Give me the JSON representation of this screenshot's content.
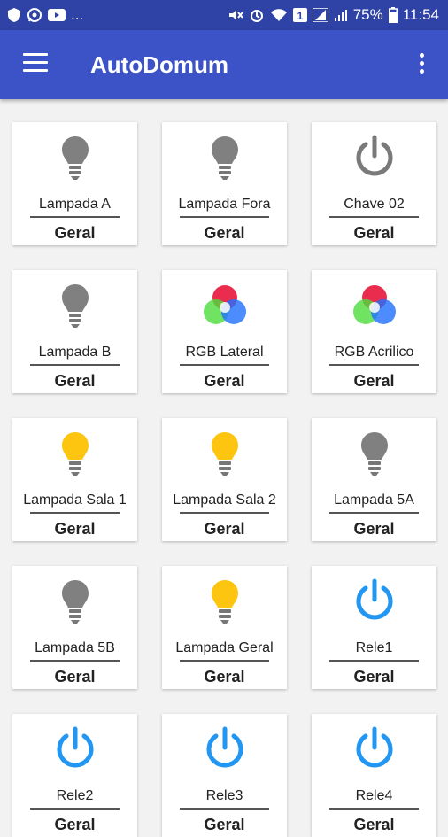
{
  "status_bar": {
    "left_text": "...",
    "battery": "75%",
    "time": "11:54",
    "icons": [
      "shield-icon",
      "whatsapp-icon",
      "youtube-icon",
      "mute-icon",
      "alarm-icon",
      "wifi-icon",
      "notification-1-icon",
      "signal-icon",
      "signal-2-icon"
    ]
  },
  "app_bar": {
    "title": "AutoDomum"
  },
  "colors": {
    "app_bar": "#3b53c6",
    "status_bar": "#2f43a6",
    "bulb_on": "#fdc50f",
    "bulb_off": "#808080",
    "power_blue": "#2196f3",
    "power_gray": "#7a7a7a"
  },
  "devices": [
    {
      "name": "Lampada A",
      "group": "Geral",
      "icon": "bulb-off"
    },
    {
      "name": "Lampada Fora",
      "group": "Geral",
      "icon": "bulb-off"
    },
    {
      "name": "Chave 02",
      "group": "Geral",
      "icon": "power-gray"
    },
    {
      "name": "Lampada B",
      "group": "Geral",
      "icon": "bulb-off"
    },
    {
      "name": "RGB Lateral",
      "group": "Geral",
      "icon": "rgb"
    },
    {
      "name": "RGB Acrilico",
      "group": "Geral",
      "icon": "rgb"
    },
    {
      "name": "Lampada Sala 1",
      "group": "Geral",
      "icon": "bulb-on"
    },
    {
      "name": "Lampada Sala 2",
      "group": "Geral",
      "icon": "bulb-on"
    },
    {
      "name": "Lampada 5A",
      "group": "Geral",
      "icon": "bulb-off"
    },
    {
      "name": "Lampada 5B",
      "group": "Geral",
      "icon": "bulb-off"
    },
    {
      "name": "Lampada Geral",
      "group": "Geral",
      "icon": "bulb-on"
    },
    {
      "name": "Rele1",
      "group": "Geral",
      "icon": "power-blue"
    },
    {
      "name": "Rele2",
      "group": "Geral",
      "icon": "power-blue"
    },
    {
      "name": "Rele3",
      "group": "Geral",
      "icon": "power-blue"
    },
    {
      "name": "Rele4",
      "group": "Geral",
      "icon": "power-blue"
    }
  ]
}
